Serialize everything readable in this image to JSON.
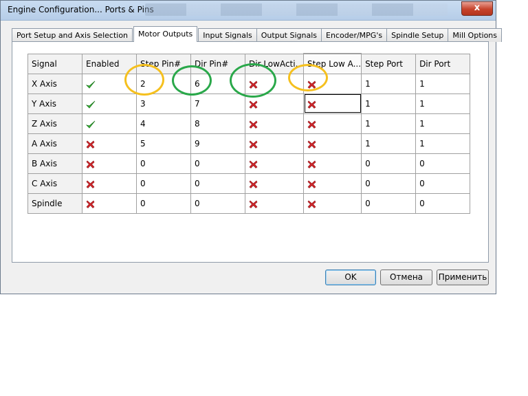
{
  "window": {
    "title": "Engine Configuration... Ports & Pins",
    "close_label": "x"
  },
  "tabs": [
    {
      "label": "Port Setup and Axis Selection",
      "active": false
    },
    {
      "label": "Motor Outputs",
      "active": true
    },
    {
      "label": "Input Signals",
      "active": false
    },
    {
      "label": "Output Signals",
      "active": false
    },
    {
      "label": "Encoder/MPG's",
      "active": false
    },
    {
      "label": "Spindle Setup",
      "active": false
    },
    {
      "label": "Mill Options",
      "active": false
    }
  ],
  "table": {
    "columns": [
      "Signal",
      "Enabled",
      "Step Pin#",
      "Dir Pin#",
      "Dir LowActi...",
      "Step Low A...",
      "Step Port",
      "Dir Port"
    ],
    "rows": [
      {
        "signal": "X Axis",
        "enabled": true,
        "step_pin": "2",
        "dir_pin": "6",
        "dir_low": false,
        "step_low": false,
        "step_port": "1",
        "dir_port": "1"
      },
      {
        "signal": "Y Axis",
        "enabled": true,
        "step_pin": "3",
        "dir_pin": "7",
        "dir_low": false,
        "step_low": false,
        "step_port": "1",
        "dir_port": "1"
      },
      {
        "signal": "Z Axis",
        "enabled": true,
        "step_pin": "4",
        "dir_pin": "8",
        "dir_low": false,
        "step_low": false,
        "step_port": "1",
        "dir_port": "1"
      },
      {
        "signal": "A Axis",
        "enabled": false,
        "step_pin": "5",
        "dir_pin": "9",
        "dir_low": false,
        "step_low": false,
        "step_port": "1",
        "dir_port": "1"
      },
      {
        "signal": "B Axis",
        "enabled": false,
        "step_pin": "0",
        "dir_pin": "0",
        "dir_low": false,
        "step_low": false,
        "step_port": "0",
        "dir_port": "0"
      },
      {
        "signal": "C Axis",
        "enabled": false,
        "step_pin": "0",
        "dir_pin": "0",
        "dir_low": false,
        "step_low": false,
        "step_port": "0",
        "dir_port": "0"
      },
      {
        "signal": "Spindle",
        "enabled": false,
        "step_pin": "0",
        "dir_pin": "0",
        "dir_low": false,
        "step_low": false,
        "step_port": "0",
        "dir_port": "0"
      }
    ]
  },
  "buttons": {
    "ok": "OK",
    "cancel": "Отмена",
    "apply": "Применить"
  },
  "colors": {
    "check_green": "#3cb83c",
    "x_red": "#d4262b",
    "annot_yellow": "#f5c01e",
    "annot_green": "#2aa84a"
  }
}
